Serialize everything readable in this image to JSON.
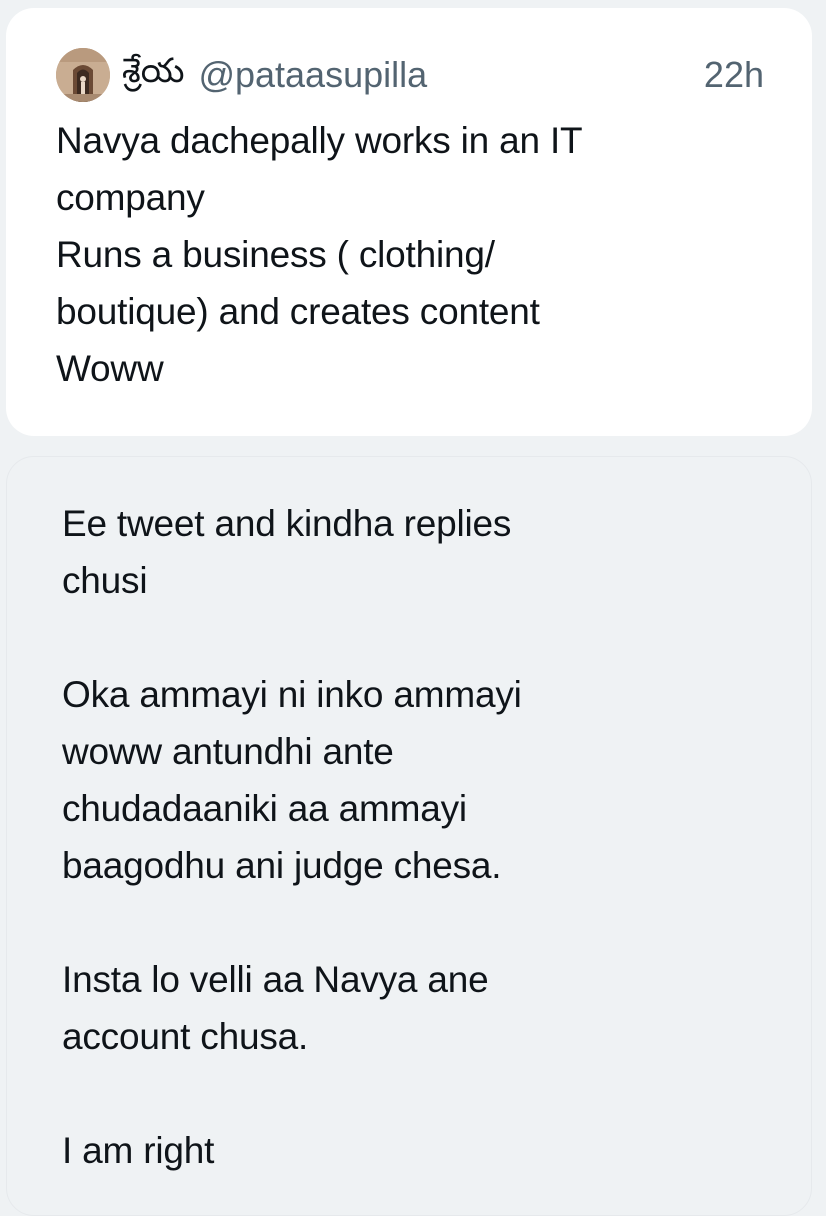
{
  "quoted_tweet": {
    "display_name": "శ్రేయ",
    "handle": "@pataasupilla",
    "time": "22h",
    "avatar_icon": "profile-photo-icon",
    "text": "Navya dachepally works in an IT\ncompany\nRuns a business ( clothing/\nboutique) and creates content\nWoww"
  },
  "reply": {
    "text": "Ee tweet and kindha replies\nchusi\n\nOka ammayi ni inko ammayi\nwoww antundhi ante\nchudadaaniki aa ammayi\nbaagodhu ani judge chesa.\n\nInsta lo velli aa Navya ane\naccount chusa.\n\nI am right"
  },
  "colors": {
    "background": "#eff2f4",
    "card": "#ffffff",
    "primary_text": "#0f1419",
    "secondary_text": "#536471"
  }
}
